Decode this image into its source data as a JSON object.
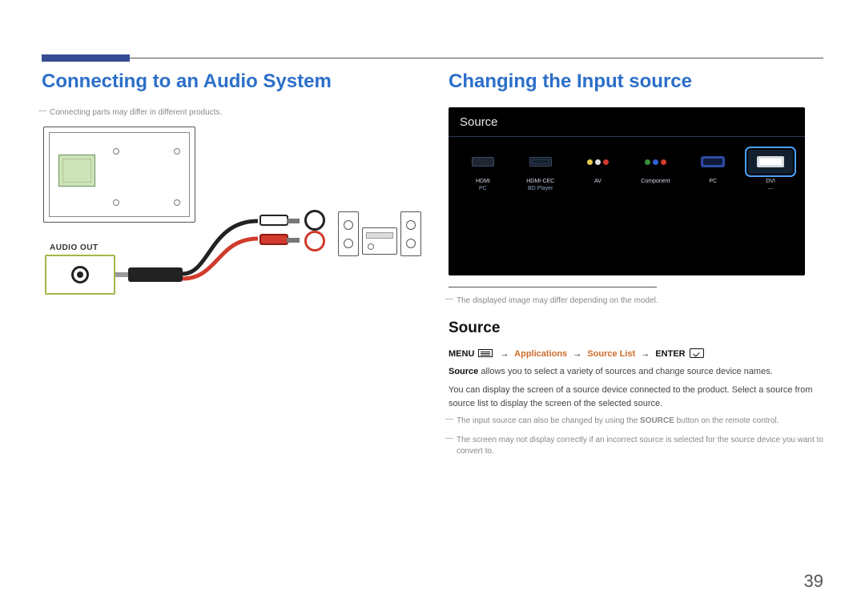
{
  "page_number": "39",
  "left": {
    "heading": "Connecting to an Audio System",
    "note": "Connecting parts may differ in different products.",
    "audio_out_label": "AUDIO OUT"
  },
  "right": {
    "heading": "Changing the Input source",
    "panel_title": "Source",
    "sources": [
      {
        "label": "HDMI",
        "sub": "PC"
      },
      {
        "label": "HDMI-CEC",
        "sub": "BD Player"
      },
      {
        "label": "AV",
        "sub": ""
      },
      {
        "label": "Component",
        "sub": ""
      },
      {
        "label": "PC",
        "sub": ""
      },
      {
        "label": "DVI",
        "sub": "—",
        "selected": true
      }
    ],
    "panel_note": "The displayed image may differ depending on the model.",
    "sub_heading": "Source",
    "nav": {
      "menu": "MENU",
      "arrow": "→",
      "applications": "Applications",
      "source_list": "Source List",
      "enter": "ENTER"
    },
    "body1_pre": "Source",
    "body1_post": " allows you to select a variety of sources and change source device names.",
    "body2": "You can display the screen of a source device connected to the product. Select a source from source list to display the screen of the selected source.",
    "foot1_pre": "The input source can also be changed by using the ",
    "foot1_bold": "SOURCE",
    "foot1_post": " button on the remote control.",
    "foot2": "The screen may not display correctly if an incorrect source is selected for the source device you want to convert to."
  }
}
